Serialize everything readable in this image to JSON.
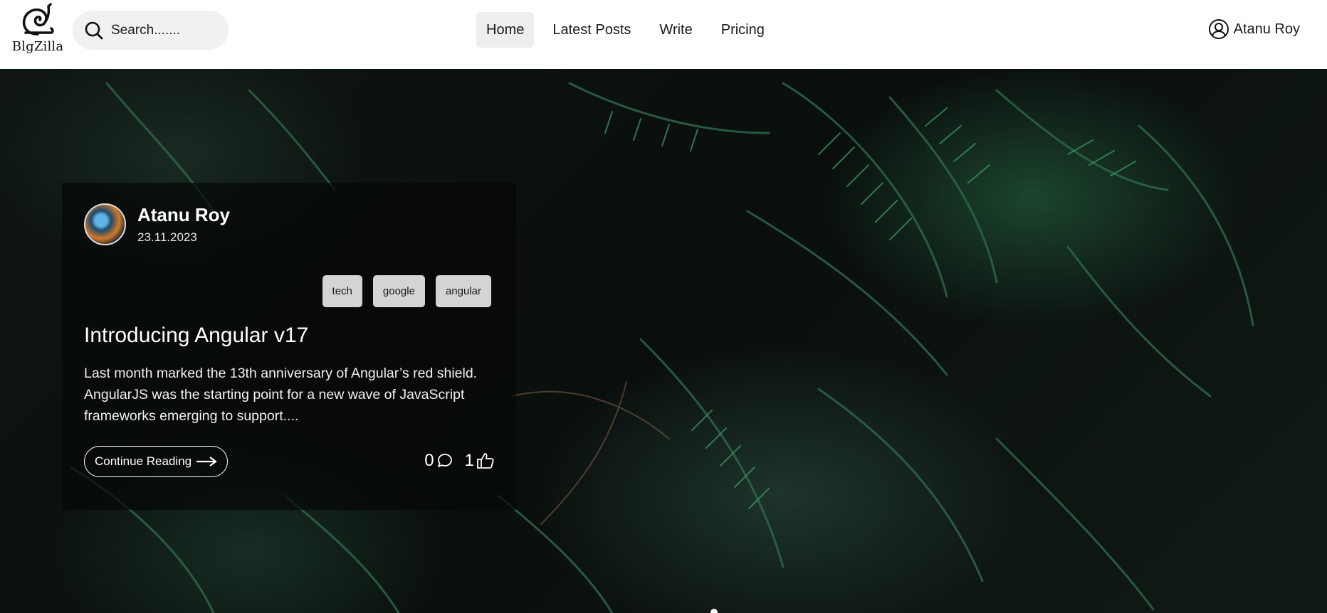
{
  "header": {
    "logo_text": "BlgZilla",
    "search_placeholder": "Search.......",
    "nav": [
      {
        "label": "Home",
        "active": true
      },
      {
        "label": "Latest Posts",
        "active": false
      },
      {
        "label": "Write",
        "active": false
      },
      {
        "label": "Pricing",
        "active": false
      }
    ],
    "user_name": "Atanu Roy",
    "icons": {
      "search": "search-icon",
      "user": "user-circle-icon",
      "logo": "snail-logo-icon"
    }
  },
  "post": {
    "author": "Atanu Roy",
    "date": "23.11.2023",
    "tags": [
      "tech",
      "google",
      "angular"
    ],
    "title": "Introducing Angular v17",
    "excerpt": "Last month marked the 13th anniversary of Angular’s red shield. AngularJS was the starting point for a new wave of JavaScript frameworks emerging to support....",
    "continue_label": "Continue Reading",
    "comments": "0",
    "likes": "1",
    "icons": {
      "comment": "comment-icon",
      "like": "thumbs-up-icon",
      "arrow": "arrow-right-icon"
    }
  },
  "colors": {
    "header_bg": "#ffffff",
    "nav_active_bg": "#eeeeee",
    "tag_bg": "#d4d4d6",
    "card_bg": "rgba(6,8,7,0.72)"
  }
}
